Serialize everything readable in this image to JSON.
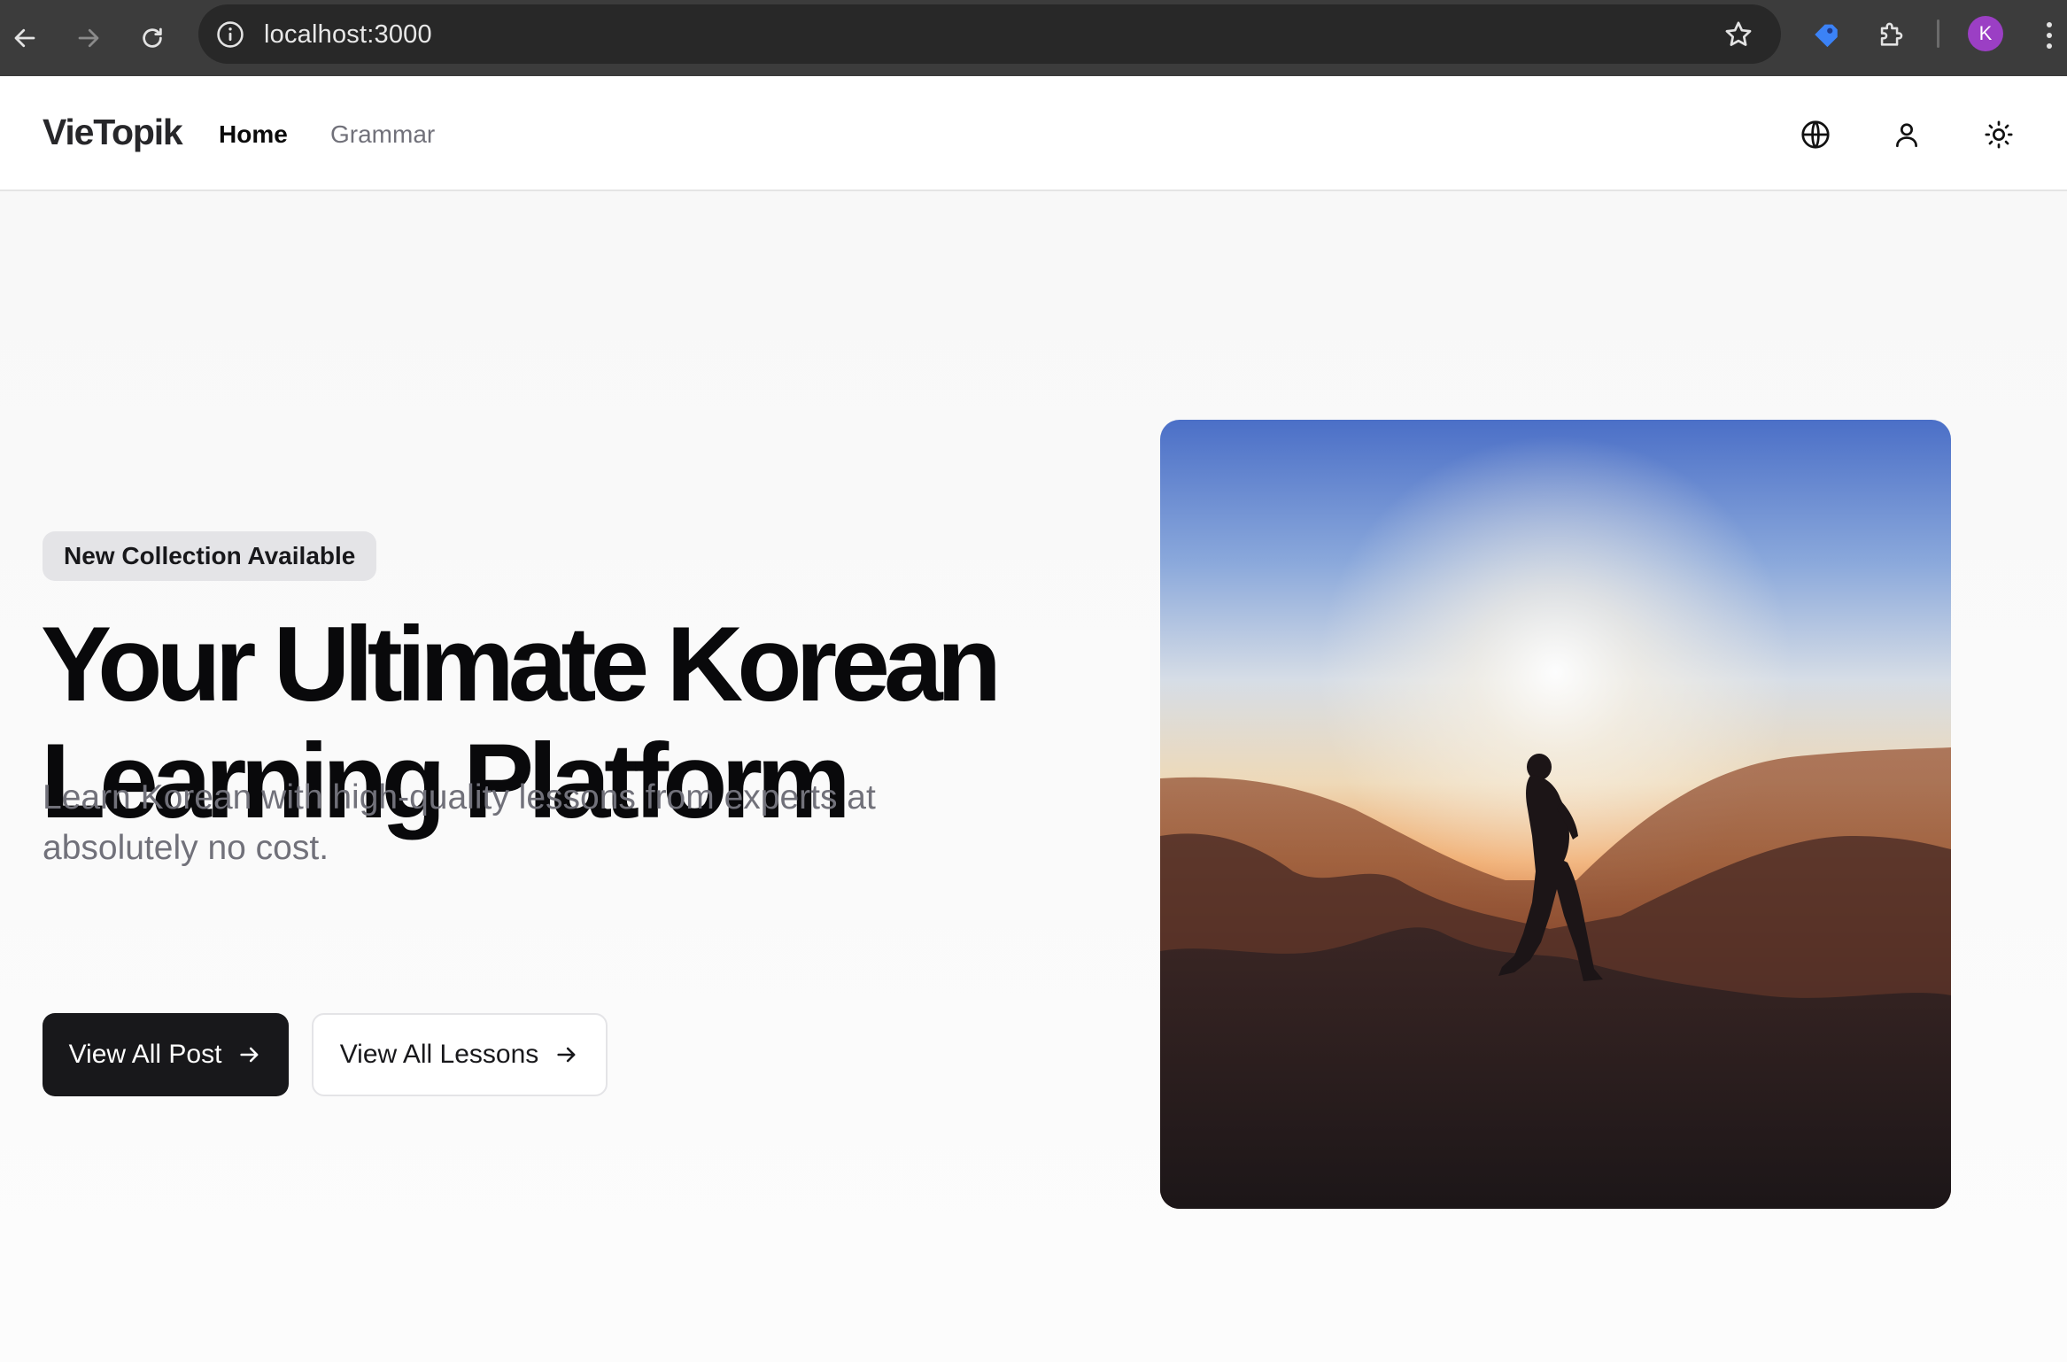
{
  "browser": {
    "url": "localhost:3000",
    "profile_initial": "K",
    "icons": [
      "back-arrow-icon",
      "forward-arrow-icon",
      "reload-icon",
      "info-icon",
      "star-icon",
      "extension-tag-icon",
      "puzzle-icon",
      "more-vert-icon"
    ]
  },
  "header": {
    "logo": "VieTopik",
    "nav": [
      {
        "label": "Home",
        "active": true
      },
      {
        "label": "Grammar",
        "active": false
      }
    ],
    "icons": [
      "globe-icon",
      "user-icon",
      "sun-icon"
    ]
  },
  "hero": {
    "badge": "New Collection Available",
    "title_line1": "Your Ultimate Korean",
    "title_line2": "Learning Platform",
    "subtitle_line1": "Learn Korean with high-quality lessons from experts at",
    "subtitle_line2": "absolutely no cost.",
    "primary_button": "View All Post",
    "secondary_button": "View All Lessons",
    "image_description": "silhouette of person on mountain at sunset"
  },
  "colors": {
    "chrome_bg": "#3c3c3c",
    "omnibox_bg": "#282828",
    "avatar": "#9b3fc4",
    "primary_button": "#18181b",
    "muted_text": "#71717a"
  }
}
